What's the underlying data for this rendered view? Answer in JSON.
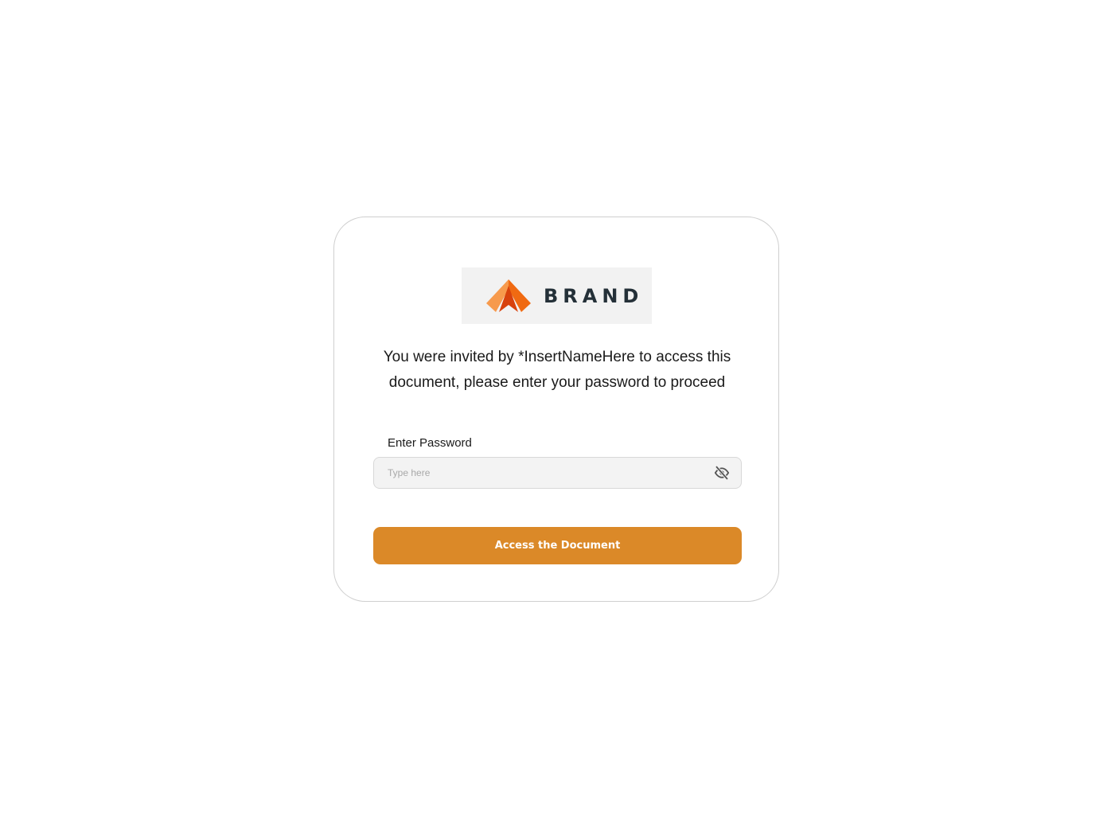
{
  "brand": {
    "name": "BRAND",
    "logo_icon": "tent-logo-icon",
    "colors": {
      "primary": "#f06a12",
      "light": "#f79a4c",
      "dark": "#d8420c"
    }
  },
  "message": "You were invited by *InsertNameHere to access this document, please enter your password to proceed",
  "password_field": {
    "label": "Enter Password",
    "placeholder": "Type here",
    "value": "",
    "toggle_icon": "eye-off-icon"
  },
  "submit": {
    "label": "Access the Document",
    "color": "#db8928"
  }
}
